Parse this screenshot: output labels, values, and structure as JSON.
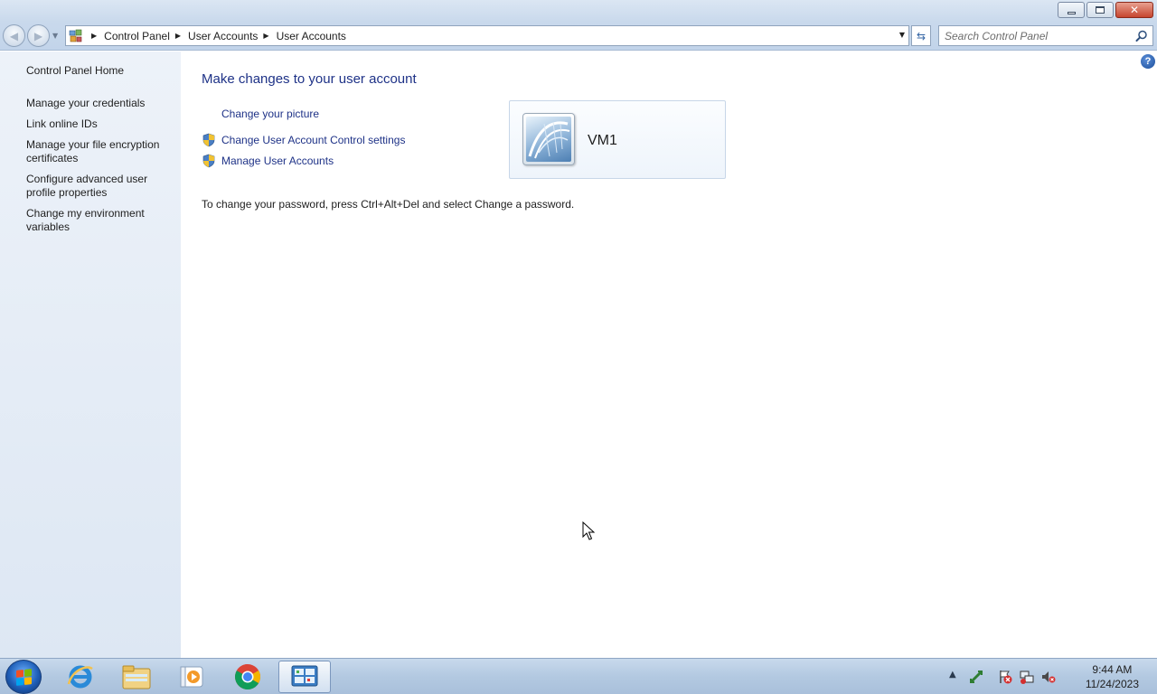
{
  "window": {
    "controls": {
      "minimize": "minimize",
      "maximize": "restore",
      "close": "✕"
    }
  },
  "address": {
    "breadcrumbs": [
      "Control Panel",
      "User Accounts",
      "User Accounts"
    ]
  },
  "search": {
    "placeholder": "Search Control Panel"
  },
  "sidebar": {
    "items": [
      {
        "label": "Control Panel Home"
      },
      {
        "label": "Manage your credentials"
      },
      {
        "label": "Link online IDs"
      },
      {
        "label": "Manage your file encryption certificates"
      },
      {
        "label": "Configure advanced user profile properties"
      },
      {
        "label": "Change my environment variables"
      }
    ]
  },
  "main": {
    "title": "Make changes to your user account",
    "tasks": [
      {
        "label": "Change your picture",
        "shield": false
      },
      {
        "label": "Change User Account Control settings",
        "shield": true
      },
      {
        "label": "Manage User Accounts",
        "shield": true
      }
    ],
    "note": "To change your password, press Ctrl+Alt+Del and select Change a password.",
    "user": {
      "name": "VM1"
    }
  },
  "help": {
    "glyph": "?"
  },
  "taskbar": {
    "apps": [
      {
        "name": "internet-explorer-icon"
      },
      {
        "name": "file-explorer-icon"
      },
      {
        "name": "media-player-icon"
      },
      {
        "name": "chrome-icon"
      },
      {
        "name": "control-panel-icon",
        "active": true
      }
    ],
    "clock": {
      "time": "9:44 AM",
      "date": "11/24/2023"
    }
  },
  "colors": {
    "link": "#1e3287",
    "sidebar_bg": "#e4ecf6",
    "taskbar_bg": "#b3c9e1"
  }
}
